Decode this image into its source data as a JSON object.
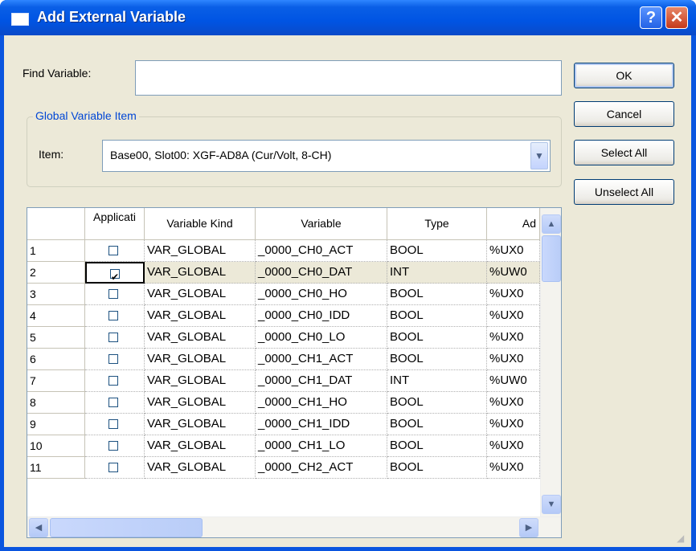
{
  "window": {
    "title": "Add External Variable",
    "help": "?",
    "close": "✕"
  },
  "find": {
    "label": "Find Variable:",
    "value": ""
  },
  "group": {
    "title": "Global Variable Item",
    "item_label": "Item:",
    "item_value": "Base00, Slot00: XGF-AD8A (Cur/Volt, 8-CH)"
  },
  "buttons": {
    "ok": "OK",
    "cancel": "Cancel",
    "select_all": "Select All",
    "unselect_all": "Unselect All"
  },
  "grid": {
    "columns": [
      "",
      "Applicati",
      "Variable Kind",
      "Variable",
      "Type",
      "Ad"
    ],
    "rows": [
      {
        "n": "1",
        "checked": false,
        "kind": "VAR_GLOBAL",
        "variable": "_0000_CH0_ACT",
        "type": "BOOL",
        "addr": "%UX0"
      },
      {
        "n": "2",
        "checked": true,
        "kind": "VAR_GLOBAL",
        "variable": "_0000_CH0_DAT",
        "type": "INT",
        "addr": "%UW0"
      },
      {
        "n": "3",
        "checked": false,
        "kind": "VAR_GLOBAL",
        "variable": "_0000_CH0_HO",
        "type": "BOOL",
        "addr": "%UX0"
      },
      {
        "n": "4",
        "checked": false,
        "kind": "VAR_GLOBAL",
        "variable": "_0000_CH0_IDD",
        "type": "BOOL",
        "addr": "%UX0"
      },
      {
        "n": "5",
        "checked": false,
        "kind": "VAR_GLOBAL",
        "variable": "_0000_CH0_LO",
        "type": "BOOL",
        "addr": "%UX0"
      },
      {
        "n": "6",
        "checked": false,
        "kind": "VAR_GLOBAL",
        "variable": "_0000_CH1_ACT",
        "type": "BOOL",
        "addr": "%UX0"
      },
      {
        "n": "7",
        "checked": false,
        "kind": "VAR_GLOBAL",
        "variable": "_0000_CH1_DAT",
        "type": "INT",
        "addr": "%UW0"
      },
      {
        "n": "8",
        "checked": false,
        "kind": "VAR_GLOBAL",
        "variable": "_0000_CH1_HO",
        "type": "BOOL",
        "addr": "%UX0"
      },
      {
        "n": "9",
        "checked": false,
        "kind": "VAR_GLOBAL",
        "variable": "_0000_CH1_IDD",
        "type": "BOOL",
        "addr": "%UX0"
      },
      {
        "n": "10",
        "checked": false,
        "kind": "VAR_GLOBAL",
        "variable": "_0000_CH1_LO",
        "type": "BOOL",
        "addr": "%UX0"
      },
      {
        "n": "11",
        "checked": false,
        "kind": "VAR_GLOBAL",
        "variable": "_0000_CH2_ACT",
        "type": "BOOL",
        "addr": "%UX0"
      }
    ],
    "selected_row": 2
  }
}
